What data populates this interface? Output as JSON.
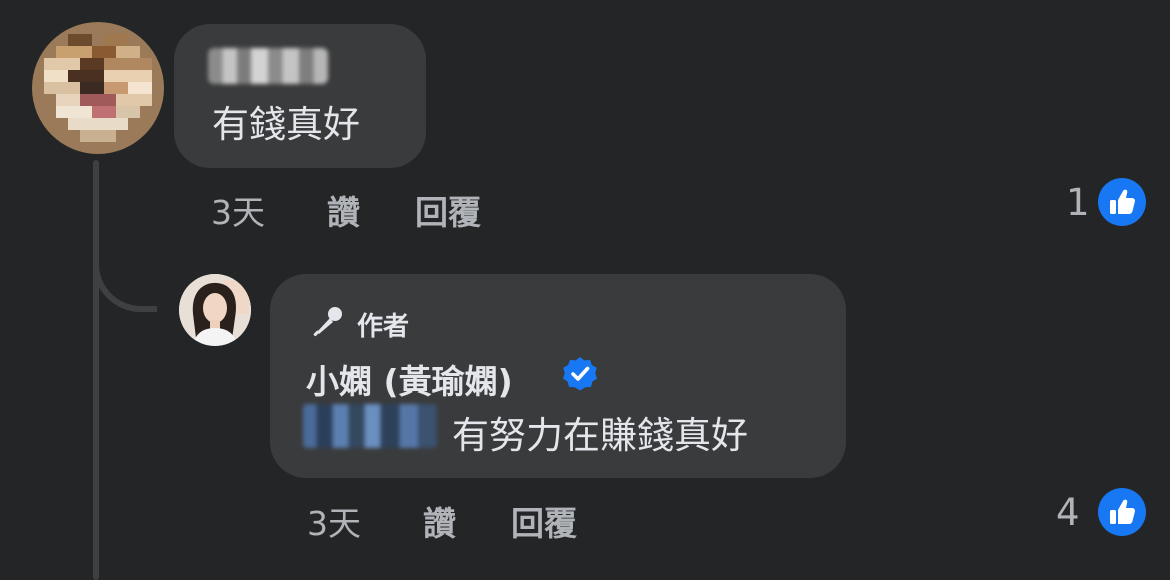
{
  "comments": [
    {
      "author_blurred": true,
      "text": "有錢真好",
      "time": "3天",
      "like_label": "讚",
      "reply_label": "回覆",
      "like_count": "1"
    },
    {
      "author_tag": "作者",
      "author": "小嫻 (黃瑜嫻)",
      "verified": true,
      "mention_blurred": true,
      "text": "有努力在賺錢真好",
      "time": "3天",
      "like_label": "讚",
      "reply_label": "回覆",
      "like_count": "4"
    }
  ],
  "colors": {
    "background": "#242526",
    "bubble": "#3a3b3c",
    "primary_text": "#e4e6eb",
    "secondary_text": "#b0b3b8",
    "like_blue": "#1877f2",
    "verified_blue": "#1877f2",
    "thread_line": "#3e4042"
  },
  "icons": [
    "microphone-icon",
    "verified-badge-icon",
    "thumbs-up-icon"
  ]
}
